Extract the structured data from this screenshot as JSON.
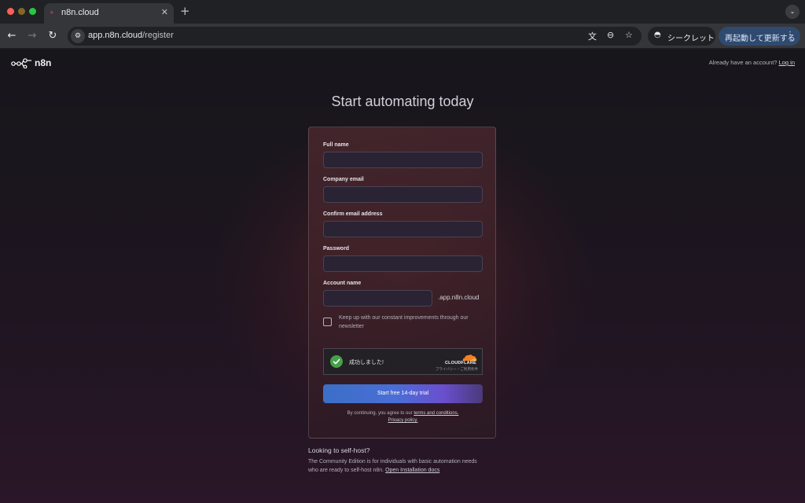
{
  "browser": {
    "tab_title": "n8n.cloud",
    "tab_close": "✕",
    "new_tab": "+",
    "tab_menu": "⌄",
    "url_host": "app.n8n.cloud",
    "url_path": "/register",
    "incognito_label": "シークレット",
    "relaunch_label": "再起動して更新する",
    "kebab": "⋮",
    "icons": [
      "back-icon",
      "forward-icon",
      "reload-icon",
      "site-info-icon",
      "translate-icon",
      "zoom-icon",
      "star-icon",
      "incognito-icon"
    ]
  },
  "header": {
    "logo_text": "n8n",
    "have_account": "Already have an account?",
    "login_link": "Log in"
  },
  "headline": "Start automating today",
  "form": {
    "full_name_label": "Full name",
    "company_email_label": "Company email",
    "confirm_email_label": "Confirm email address",
    "password_label": "Password",
    "account_name_label": "Account name",
    "account_suffix": ".app.n8n.cloud",
    "newsletter_label": "Keep up with our constant improvements through our newsletter",
    "turnstile": {
      "status": "成功しました!",
      "brand": "CLOUDFLARE",
      "links": "プライバシー・ご利用条件"
    },
    "cta_label": "Start free 14-day trial",
    "legal_prefix": "By continuing, you agree to our",
    "terms_link": "terms and conditions.",
    "privacy_link": "Privacy policy."
  },
  "selfhost": {
    "title": "Looking to self-host?",
    "text": "The Community Edition is for individuals with basic automation needs who are ready to self-host n8n.",
    "docs_link": "Open Installation docs"
  },
  "colors": {
    "accent_cta_start": "#3b6fc6",
    "accent_cta_end": "#6a4fcf",
    "turnstile_success": "#45a148",
    "cloudflare_orange": "#f48120"
  }
}
